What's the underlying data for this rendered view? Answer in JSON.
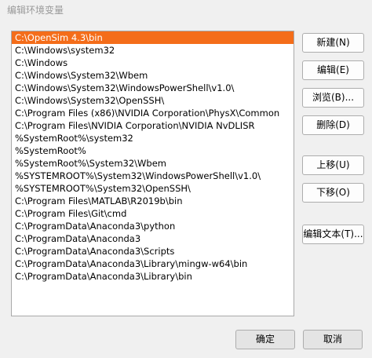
{
  "window": {
    "title": "编辑环境变量"
  },
  "list": {
    "items": [
      "C:\\OpenSim 4.3\\bin",
      "C:\\Windows\\system32",
      "C:\\Windows",
      "C:\\Windows\\System32\\Wbem",
      "C:\\Windows\\System32\\WindowsPowerShell\\v1.0\\",
      "C:\\Windows\\System32\\OpenSSH\\",
      "C:\\Program Files (x86)\\NVIDIA Corporation\\PhysX\\Common",
      "C:\\Program Files\\NVIDIA Corporation\\NVIDIA NvDLISR",
      "%SystemRoot%\\system32",
      "%SystemRoot%",
      "%SystemRoot%\\System32\\Wbem",
      "%SYSTEMROOT%\\System32\\WindowsPowerShell\\v1.0\\",
      "%SYSTEMROOT%\\System32\\OpenSSH\\",
      "C:\\Program Files\\MATLAB\\R2019b\\bin",
      "C:\\Program Files\\Git\\cmd",
      "C:\\ProgramData\\Anaconda3\\python",
      "C:\\ProgramData\\Anaconda3",
      "C:\\ProgramData\\Anaconda3\\Scripts",
      "C:\\ProgramData\\Anaconda3\\Library\\mingw-w64\\bin",
      "C:\\ProgramData\\Anaconda3\\Library\\bin"
    ],
    "selected_index": 0
  },
  "buttons": {
    "new": "新建(N)",
    "edit": "编辑(E)",
    "browse": "浏览(B)...",
    "delete": "删除(D)",
    "move_up": "上移(U)",
    "move_down": "下移(O)",
    "edit_text": "编辑文本(T)...",
    "ok": "确定",
    "cancel": "取消"
  },
  "colors": {
    "selection": "#f46d1a",
    "background": "#f0f0f0"
  }
}
